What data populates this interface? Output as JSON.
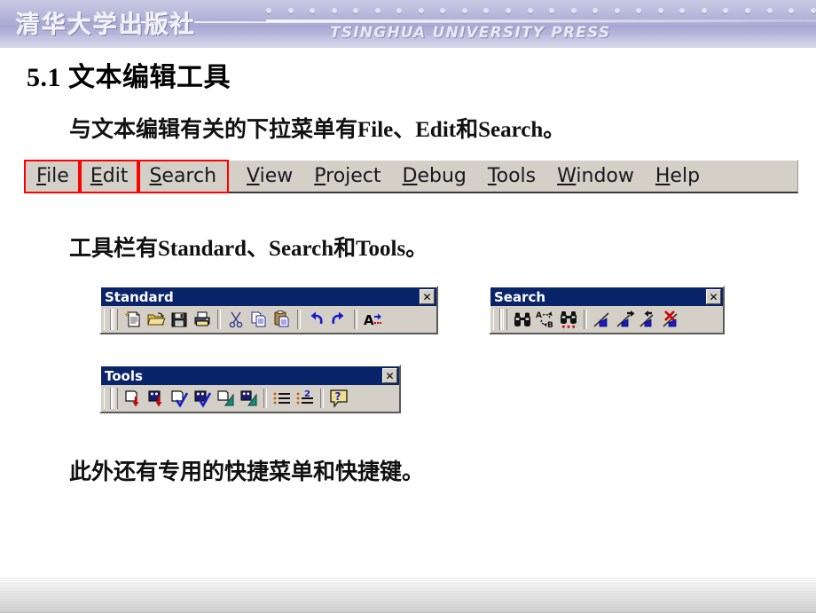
{
  "banner": {
    "logo_cn": "清华大学出版社",
    "logo_en": "TSINGHUA UNIVERSITY PRESS",
    "dot_count": 26,
    "gradient_from": "#c9c9e4",
    "gradient_to": "#a7a7d2"
  },
  "slide": {
    "title": "5.1 文本编辑工具",
    "line_menus": "与文本编辑有关的下拉菜单有File、Edit和Search。",
    "line_toolbars": "工具栏有Standard、Search和Tools。",
    "line_extra": "此外还有专用的快捷菜单和快捷键。"
  },
  "menubar": {
    "highlight_color": "#ff0000",
    "items": [
      {
        "label": "File",
        "accel": "F",
        "rest": "ile",
        "highlighted": true
      },
      {
        "label": "Edit",
        "accel": "E",
        "rest": "dit",
        "highlighted": true
      },
      {
        "label": "Search",
        "accel": "S",
        "rest": "earch",
        "highlighted": true
      },
      {
        "label": "View",
        "accel": "V",
        "rest": "iew",
        "highlighted": false
      },
      {
        "label": "Project",
        "accel": "P",
        "rest": "roject",
        "highlighted": false
      },
      {
        "label": "Debug",
        "accel": "D",
        "rest": "ebug",
        "highlighted": false
      },
      {
        "label": "Tools",
        "accel": "T",
        "rest": "ools",
        "highlighted": false
      },
      {
        "label": "Window",
        "accel": "W",
        "rest": "indow",
        "highlighted": false
      },
      {
        "label": "Help",
        "accel": "H",
        "rest": "elp",
        "highlighted": false
      }
    ]
  },
  "toolbars": {
    "standard": {
      "title": "Standard",
      "close_label": "✕",
      "titlebar_color": "#0a246a",
      "face_color": "#d4d0c8",
      "buttons": [
        {
          "icon": "new-file-icon",
          "name": "New"
        },
        {
          "icon": "open-folder-icon",
          "name": "Open"
        },
        {
          "icon": "save-disk-icon",
          "name": "Save"
        },
        {
          "icon": "print-icon",
          "name": "Print"
        },
        {
          "icon": "separator",
          "name": ""
        },
        {
          "icon": "cut-scissors-icon",
          "name": "Cut"
        },
        {
          "icon": "copy-icon",
          "name": "Copy"
        },
        {
          "icon": "paste-icon",
          "name": "Paste"
        },
        {
          "icon": "separator",
          "name": ""
        },
        {
          "icon": "undo-arrow-icon",
          "name": "Undo"
        },
        {
          "icon": "redo-arrow-icon",
          "name": "Redo"
        },
        {
          "icon": "separator",
          "name": ""
        },
        {
          "icon": "font-icon",
          "name": "Font"
        }
      ]
    },
    "search": {
      "title": "Search",
      "close_label": "✕",
      "buttons": [
        {
          "icon": "binoculars-find-icon",
          "name": "Find"
        },
        {
          "icon": "replace-a-to-b-icon",
          "name": "Replace"
        },
        {
          "icon": "binoculars-find-in-files-icon",
          "name": "Find in Files"
        },
        {
          "icon": "separator",
          "name": ""
        },
        {
          "icon": "flag-toggle-bookmark-icon",
          "name": "Toggle Bookmark"
        },
        {
          "icon": "flag-next-bookmark-icon",
          "name": "Next Bookmark"
        },
        {
          "icon": "flag-prev-bookmark-icon",
          "name": "Previous Bookmark"
        },
        {
          "icon": "flag-clear-bookmarks-icon",
          "name": "Clear Bookmarks"
        }
      ]
    },
    "tools": {
      "title": "Tools",
      "close_label": "✕",
      "buttons": [
        {
          "icon": "compile-file-down-icon",
          "name": "Compile File"
        },
        {
          "icon": "compile-project-down-icon",
          "name": "Compile Project"
        },
        {
          "icon": "check-file-icon",
          "name": "Check Syntax File"
        },
        {
          "icon": "check-project-icon",
          "name": "Check Syntax Project"
        },
        {
          "icon": "build-file-icon",
          "name": "Build File"
        },
        {
          "icon": "build-project-icon",
          "name": "Build Project"
        },
        {
          "icon": "separator",
          "name": ""
        },
        {
          "icon": "list-errors-icon",
          "name": "Errors List"
        },
        {
          "icon": "list-next-error-icon",
          "name": "Next Error"
        },
        {
          "icon": "separator",
          "name": ""
        },
        {
          "icon": "help-question-icon",
          "name": "Help"
        }
      ]
    }
  }
}
